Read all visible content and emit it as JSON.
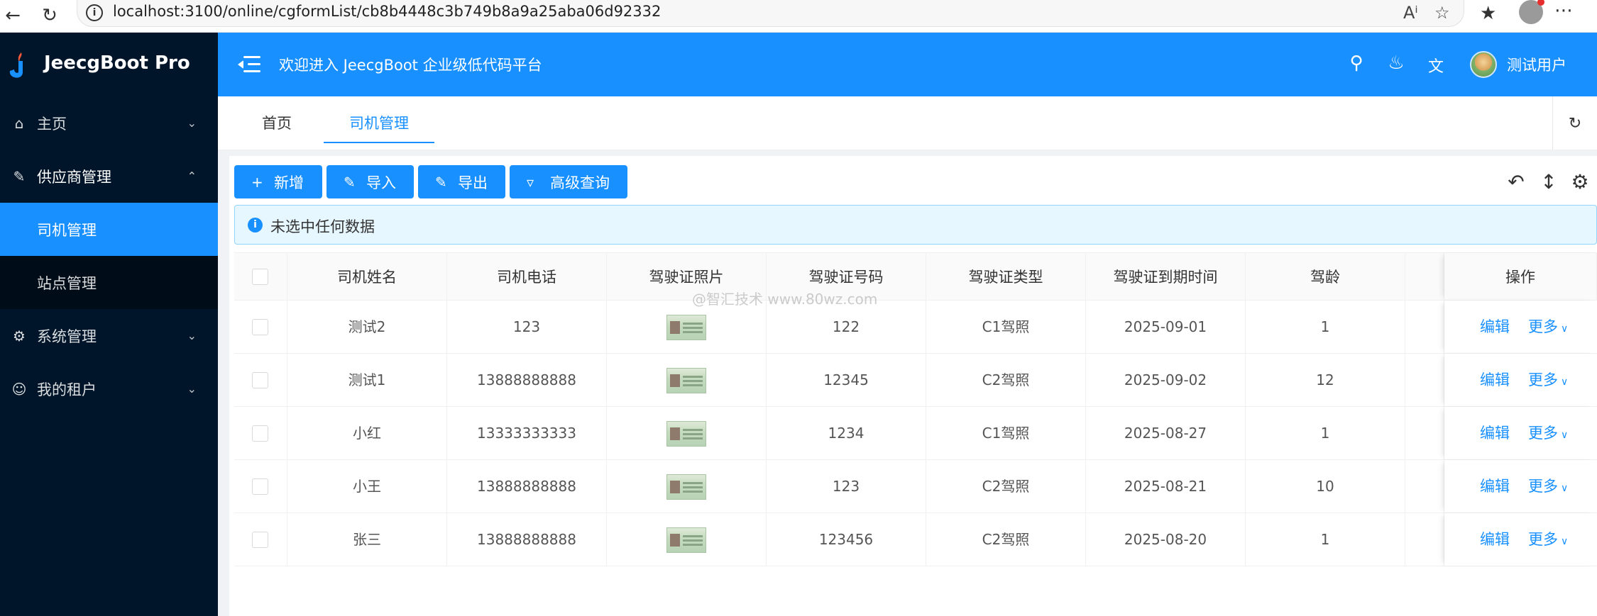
{
  "browser": {
    "url": "localhost:3100/online/cgformList/cb8b4448c3b749b8a9a25aba06d92332"
  },
  "sidebar": {
    "app_name": "JeecgBoot Pro",
    "items": [
      {
        "label": "主页",
        "icon": "home-icon"
      },
      {
        "label": "供应商管理",
        "icon": "brush-icon"
      },
      {
        "label": "司机管理"
      },
      {
        "label": "站点管理"
      },
      {
        "label": "系统管理",
        "icon": "gear-icon"
      },
      {
        "label": "我的租户",
        "icon": "user-icon"
      }
    ]
  },
  "header": {
    "welcome": "欢迎进入 JeecgBoot 企业级低代码平台",
    "user_name": "测试用户"
  },
  "tabs": [
    {
      "label": "首页"
    },
    {
      "label": "司机管理",
      "active": true
    }
  ],
  "toolbar": {
    "add": "新增",
    "import": "导入",
    "export": "导出",
    "advanced_query": "高级查询"
  },
  "alert": {
    "text": "未选中任何数据"
  },
  "table": {
    "columns": [
      "司机姓名",
      "司机电话",
      "驾驶证照片",
      "驾驶证号码",
      "驾驶证类型",
      "驾驶证到期时间",
      "驾龄",
      "",
      "操作"
    ],
    "rows": [
      {
        "name": "测试2",
        "phone": "123",
        "license_no": "122",
        "license_type": "C1驾照",
        "expire": "2025-09-01",
        "years": "1"
      },
      {
        "name": "测试1",
        "phone": "13888888888",
        "license_no": "12345",
        "license_type": "C2驾照",
        "expire": "2025-09-02",
        "years": "12"
      },
      {
        "name": "小红",
        "phone": "13333333333",
        "license_no": "1234",
        "license_type": "C1驾照",
        "expire": "2025-08-27",
        "years": "1"
      },
      {
        "name": "小王",
        "phone": "13888888888",
        "license_no": "123",
        "license_type": "C2驾照",
        "expire": "2025-08-21",
        "years": "10"
      },
      {
        "name": "张三",
        "phone": "13888888888",
        "license_no": "123456",
        "license_type": "C2驾照",
        "expire": "2025-08-20",
        "years": "1"
      }
    ],
    "edit_label": "编辑",
    "more_label": "更多"
  },
  "watermark": "@智汇技术 www.80wz.com",
  "colors": {
    "primary": "#1890ff",
    "sidebar": "#001529",
    "sidebar_sub": "#000c17"
  }
}
